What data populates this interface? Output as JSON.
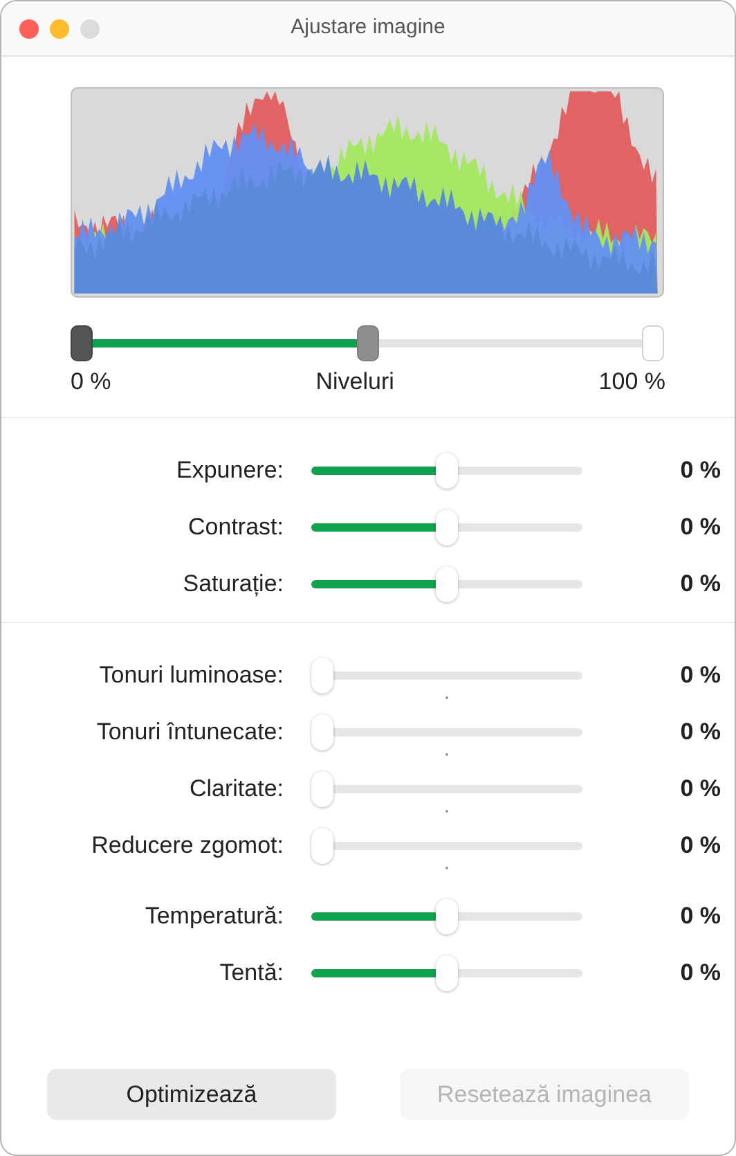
{
  "window": {
    "title": "Ajustare imagine"
  },
  "levels": {
    "label": "Niveluri",
    "min_label": "0 %",
    "max_label": "100 %",
    "thumbs": [
      {
        "kind": "black",
        "level": 0
      },
      {
        "kind": "gray",
        "level": 0.5
      },
      {
        "kind": "white",
        "level": 1
      }
    ]
  },
  "sections": [
    {
      "separated": true,
      "rows": [
        {
          "label": "Expunere:",
          "kind": "centered",
          "level": 0.5,
          "value": "0 %"
        },
        {
          "label": "Contrast:",
          "kind": "centered",
          "level": 0.5,
          "value": "0 %"
        },
        {
          "label": "Saturație:",
          "kind": "centered",
          "level": 0.5,
          "value": "0 %"
        }
      ]
    },
    {
      "separated": true,
      "rows": [
        {
          "label": "Tonuri luminoase:",
          "kind": "ticked",
          "level": 0,
          "value": "0 %"
        },
        {
          "label": "Tonuri întunecate:",
          "kind": "ticked",
          "level": 0,
          "value": "0 %"
        },
        {
          "label": "Claritate:",
          "kind": "ticked",
          "level": 0,
          "value": "0 %"
        },
        {
          "label": "Reducere zgomot:",
          "kind": "ticked",
          "level": 0,
          "value": "0 %"
        }
      ]
    },
    {
      "separated": false,
      "rows": [
        {
          "label": "Temperatură:",
          "kind": "centered",
          "level": 0.5,
          "value": "0 %"
        },
        {
          "label": "Tentă:",
          "kind": "centered",
          "level": 0.5,
          "value": "0 %"
        }
      ]
    }
  ],
  "buttons": [
    {
      "label": "Optimizează",
      "disabled": false
    },
    {
      "label": "Resetează imaginea",
      "disabled": true
    }
  ]
}
